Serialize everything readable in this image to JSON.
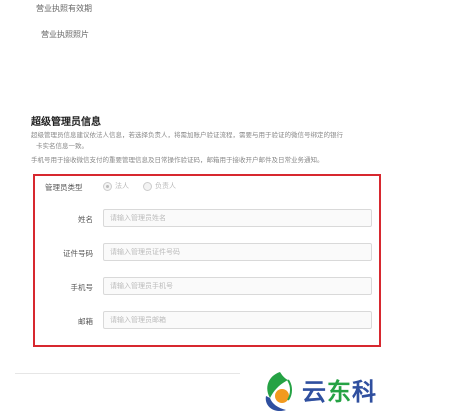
{
  "top": {
    "line1": "营业执照有效期",
    "line2": "营业执照照片"
  },
  "section": {
    "title": "超级管理员信息",
    "desc1": "超级管理员信息建议依法人信息，若选择负责人，将需加账户验证流程，需要与用于验证的微信号绑定的银行",
    "desc2": "卡实名信息一致。",
    "desc3": "手机号用于接收微信支付的重要管理信息及日常操作验证码，邮箱用于接收开户邮件及日常业务通知。"
  },
  "form": {
    "admin_type_label": "管理员类型",
    "radio_options": [
      "法人",
      "负责人"
    ],
    "selected_option": "法人",
    "fields": [
      {
        "label": "姓名",
        "placeholder": "请输入管理员姓名",
        "value": ""
      },
      {
        "label": "证件号码",
        "placeholder": "请输入管理员证件号码",
        "value": ""
      },
      {
        "label": "手机号",
        "placeholder": "请输入管理员手机号",
        "value": ""
      },
      {
        "label": "邮箱",
        "placeholder": "请输入管理员邮箱",
        "value": ""
      }
    ]
  },
  "watermark": {
    "text_blue": "云",
    "text_green": "东",
    "text_rest": "科"
  },
  "colors": {
    "highlight_border": "#d7282f",
    "watermark_blue": "#2f4f9f",
    "watermark_green": "#25a244"
  }
}
